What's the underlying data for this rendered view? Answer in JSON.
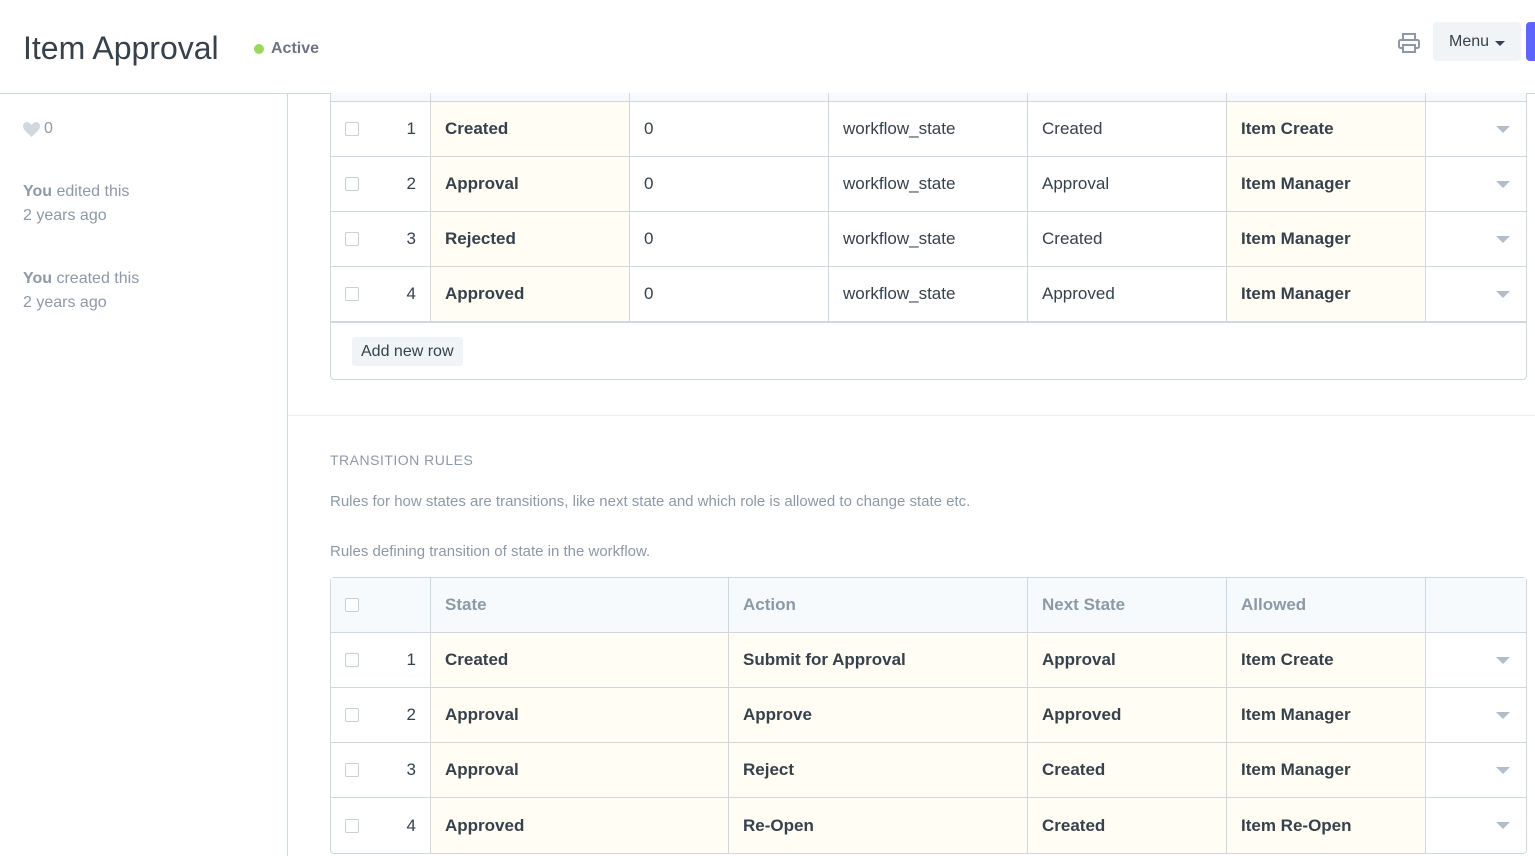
{
  "header": {
    "title": "Item Approval",
    "status": "Active",
    "menu_label": "Menu",
    "status_color": "#98d85b",
    "primary_color": "#5e64ff"
  },
  "sidebar": {
    "likes_count": "0",
    "activity": [
      {
        "actor": "You",
        "text": " edited this",
        "time": "2 years ago"
      },
      {
        "actor": "You",
        "text": " created this",
        "time": "2 years ago"
      }
    ]
  },
  "states_table": {
    "rows": [
      {
        "idx": "1",
        "state": "Created",
        "doc_status": "0",
        "update_field": "workflow_state",
        "update_value": "Created",
        "allow_edit": "Item Create"
      },
      {
        "idx": "2",
        "state": "Approval",
        "doc_status": "0",
        "update_field": "workflow_state",
        "update_value": "Approval",
        "allow_edit": "Item Manager"
      },
      {
        "idx": "3",
        "state": "Rejected",
        "doc_status": "0",
        "update_field": "workflow_state",
        "update_value": "Created",
        "allow_edit": "Item Manager"
      },
      {
        "idx": "4",
        "state": "Approved",
        "doc_status": "0",
        "update_field": "workflow_state",
        "update_value": "Approved",
        "allow_edit": "Item Manager"
      }
    ],
    "add_row_label": "Add new row"
  },
  "transition_section": {
    "title": "TRANSITION RULES",
    "description": "Rules for how states are transitions, like next state and which role is allowed to change state etc.",
    "field_description": "Rules defining transition of state in the workflow."
  },
  "transitions_table": {
    "headers": {
      "state": "State",
      "action": "Action",
      "next_state": "Next State",
      "allowed": "Allowed"
    },
    "rows": [
      {
        "idx": "1",
        "state": "Created",
        "action": "Submit for Approval",
        "next_state": "Approval",
        "allowed": "Item Create"
      },
      {
        "idx": "2",
        "state": "Approval",
        "action": "Approve",
        "next_state": "Approved",
        "allowed": "Item Manager"
      },
      {
        "idx": "3",
        "state": "Approval",
        "action": "Reject",
        "next_state": "Created",
        "allowed": "Item Manager"
      },
      {
        "idx": "4",
        "state": "Approved",
        "action": "Re-Open",
        "next_state": "Created",
        "allowed": "Item Re-Open"
      }
    ]
  }
}
